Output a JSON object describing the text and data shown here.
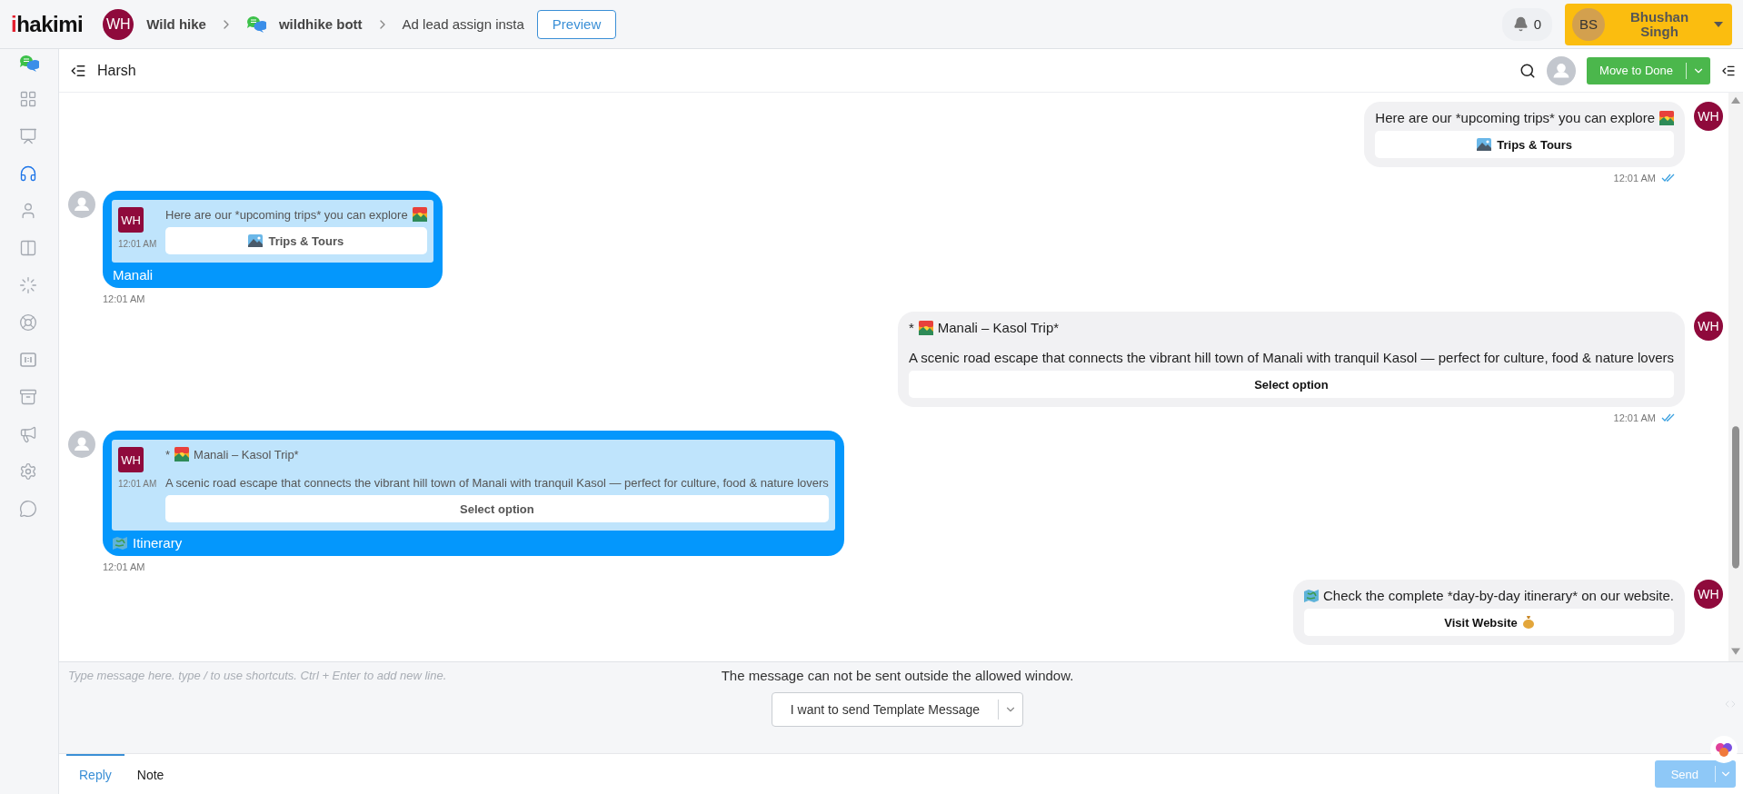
{
  "topbar": {
    "logo_mark": "i",
    "logo_text": "hakimi",
    "workspace": {
      "initials": "WH",
      "name": "Wild hike"
    },
    "bot": "wildhike bott",
    "flow": "Ad lead assign insta",
    "preview": "Preview",
    "notifications": "0",
    "user": {
      "initials": "BS",
      "name": "Bhushan Singh"
    }
  },
  "sidebar": {
    "items": [
      {
        "kind": "dashboard",
        "selected": false
      },
      {
        "kind": "reports",
        "selected": false
      },
      {
        "kind": "inbox",
        "selected": true
      },
      {
        "kind": "contacts",
        "selected": false
      },
      {
        "kind": "layout",
        "selected": false
      },
      {
        "kind": "automation",
        "selected": false
      },
      {
        "kind": "support",
        "selected": false
      },
      {
        "kind": "templates",
        "selected": false
      },
      {
        "kind": "archive",
        "selected": false
      },
      {
        "kind": "campaigns",
        "selected": false
      },
      {
        "kind": "settings",
        "selected": false
      },
      {
        "kind": "chat",
        "selected": false
      }
    ]
  },
  "chat_header": {
    "contact": "Harsh",
    "action": "Move to Done"
  },
  "messages": [
    {
      "kind": "outgoing",
      "avatar": "WH",
      "text": "Here are our *upcoming trips* you can explore",
      "buttons": [
        {
          "label": "Trips & Tours"
        }
      ],
      "time": "12:01 AM",
      "read": true
    },
    {
      "kind": "incoming",
      "quote": {
        "avatar": "WH",
        "time": "12:01 AM",
        "text": "Here are our *upcoming trips* you can explore",
        "buttons": [
          {
            "label": "Trips & Tours"
          }
        ]
      },
      "reply": "Manali",
      "time": "12:01 AM"
    },
    {
      "kind": "outgoing",
      "avatar": "WH",
      "title_prefix": "*",
      "title": "Manali – Kasol Trip*",
      "text": "A scenic road escape that connects the vibrant hill town of Manali with tranquil Kasol — perfect for culture, food & nature lovers",
      "buttons": [
        {
          "label": "Select option"
        }
      ],
      "time": "12:01 AM",
      "read": true
    },
    {
      "kind": "incoming",
      "quote": {
        "avatar": "WH",
        "time": "12:01 AM",
        "title_prefix": "*",
        "title": "Manali – Kasol Trip*",
        "text": "A scenic road escape that connects the vibrant hill town of Manali with tranquil Kasol — perfect for culture, food & nature lovers",
        "buttons": [
          {
            "label": "Select option"
          }
        ]
      },
      "reply": "Itinerary",
      "time": "12:01 AM"
    },
    {
      "kind": "outgoing",
      "avatar": "WH",
      "text": "Check the complete *day-by-day itinerary* on our website.",
      "buttons": [
        {
          "label": "Visit Website"
        }
      ]
    }
  ],
  "composer": {
    "placeholder": "Type message here. type / to use shortcuts. Ctrl + Enter to add new line.",
    "notice": "The message can not be sent outside the allowed window.",
    "template_button": "I want to send Template Message",
    "send": "Send",
    "send_disabled": true
  },
  "tabs": [
    {
      "label": "Reply",
      "selected": true
    },
    {
      "label": "Note",
      "selected": false
    }
  ]
}
